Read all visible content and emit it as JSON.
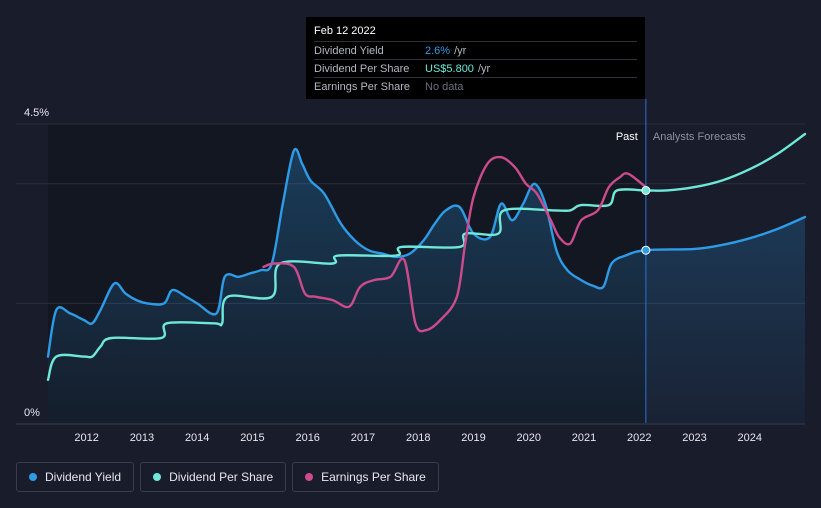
{
  "tooltip": {
    "date": "Feb 12 2022",
    "rows": [
      {
        "label": "Dividend Yield",
        "value": "2.6%",
        "unit": "/yr"
      },
      {
        "label": "Dividend Per Share",
        "value": "US$5.800",
        "unit": "/yr"
      },
      {
        "label": "Earnings Per Share",
        "value": "No data",
        "unit": ""
      }
    ]
  },
  "zones": {
    "past": "Past",
    "forecast": "Analysts Forecasts"
  },
  "legend": [
    {
      "label": "Dividend Yield",
      "color": "#2d9be6"
    },
    {
      "label": "Dividend Per Share",
      "color": "#6fe8d8"
    },
    {
      "label": "Earnings Per Share",
      "color": "#cc4b8c"
    }
  ],
  "chart_data": {
    "type": "line",
    "y_tick_labels": [
      "4.5%",
      "0%"
    ],
    "ylim": [
      0,
      4.5
    ],
    "xlim": [
      2011.3,
      2025.0
    ],
    "x_tick_labels": [
      "2012",
      "2013",
      "2014",
      "2015",
      "2016",
      "2017",
      "2018",
      "2019",
      "2020",
      "2021",
      "2022",
      "2023",
      "2024"
    ],
    "x_ticks": [
      2012,
      2013,
      2014,
      2015,
      2016,
      2017,
      2018,
      2019,
      2020,
      2021,
      2022,
      2023,
      2024
    ],
    "highlight_date": 2022.12,
    "past_zone_start": 2021.1,
    "grid": true,
    "series": [
      {
        "name": "Dividend Yield",
        "unit": "%",
        "color": "#2d9be6",
        "fill": true,
        "points": [
          [
            2011.3,
            1.0
          ],
          [
            2011.45,
            1.7
          ],
          [
            2011.7,
            1.65
          ],
          [
            2011.95,
            1.55
          ],
          [
            2012.1,
            1.5
          ],
          [
            2012.25,
            1.7
          ],
          [
            2012.5,
            2.1
          ],
          [
            2012.7,
            1.95
          ],
          [
            2012.9,
            1.85
          ],
          [
            2013.1,
            1.8
          ],
          [
            2013.4,
            1.8
          ],
          [
            2013.55,
            2.0
          ],
          [
            2013.8,
            1.9
          ],
          [
            2014.0,
            1.8
          ],
          [
            2014.35,
            1.65
          ],
          [
            2014.5,
            2.2
          ],
          [
            2014.75,
            2.2
          ],
          [
            2014.95,
            2.25
          ],
          [
            2015.15,
            2.3
          ],
          [
            2015.35,
            2.4
          ],
          [
            2015.55,
            3.3
          ],
          [
            2015.75,
            4.1
          ],
          [
            2015.9,
            3.9
          ],
          [
            2016.05,
            3.65
          ],
          [
            2016.3,
            3.45
          ],
          [
            2016.6,
            3.0
          ],
          [
            2016.85,
            2.75
          ],
          [
            2017.1,
            2.6
          ],
          [
            2017.35,
            2.55
          ],
          [
            2017.6,
            2.5
          ],
          [
            2017.85,
            2.55
          ],
          [
            2018.1,
            2.75
          ],
          [
            2018.3,
            3.0
          ],
          [
            2018.5,
            3.2
          ],
          [
            2018.75,
            3.25
          ],
          [
            2019.0,
            2.85
          ],
          [
            2019.3,
            2.8
          ],
          [
            2019.5,
            3.3
          ],
          [
            2019.7,
            3.05
          ],
          [
            2019.9,
            3.3
          ],
          [
            2020.1,
            3.6
          ],
          [
            2020.3,
            3.3
          ],
          [
            2020.5,
            2.6
          ],
          [
            2020.7,
            2.3
          ],
          [
            2020.95,
            2.15
          ],
          [
            2021.15,
            2.07
          ],
          [
            2021.35,
            2.05
          ],
          [
            2021.5,
            2.4
          ],
          [
            2021.75,
            2.52
          ],
          [
            2022.12,
            2.6
          ],
          [
            2023.0,
            2.62
          ],
          [
            2023.5,
            2.68
          ],
          [
            2024.0,
            2.78
          ],
          [
            2024.5,
            2.92
          ],
          [
            2025.0,
            3.1
          ]
        ]
      },
      {
        "name": "Dividend Per Share",
        "unit": "US$",
        "color": "#6fe8d8",
        "fill": false,
        "points": [
          [
            2011.3,
            0.65
          ],
          [
            2011.45,
            1.0
          ],
          [
            2011.95,
            1.0
          ],
          [
            2012.1,
            1.0
          ],
          [
            2012.25,
            1.15
          ],
          [
            2012.45,
            1.28
          ],
          [
            2013.35,
            1.28
          ],
          [
            2013.45,
            1.5
          ],
          [
            2014.3,
            1.5
          ],
          [
            2014.45,
            1.5
          ],
          [
            2014.55,
            1.9
          ],
          [
            2015.35,
            1.9
          ],
          [
            2015.5,
            2.4
          ],
          [
            2016.45,
            2.4
          ],
          [
            2016.55,
            2.52
          ],
          [
            2017.6,
            2.52
          ],
          [
            2017.7,
            2.65
          ],
          [
            2018.75,
            2.65
          ],
          [
            2018.85,
            2.85
          ],
          [
            2019.45,
            2.85
          ],
          [
            2019.55,
            3.2
          ],
          [
            2020.45,
            3.2
          ],
          [
            2020.75,
            3.2
          ],
          [
            2020.95,
            3.28
          ],
          [
            2021.45,
            3.28
          ],
          [
            2021.6,
            3.5
          ],
          [
            2022.12,
            3.5
          ],
          [
            2022.5,
            3.5
          ],
          [
            2023.0,
            3.55
          ],
          [
            2023.5,
            3.65
          ],
          [
            2024.0,
            3.82
          ],
          [
            2024.5,
            4.05
          ],
          [
            2025.0,
            4.35
          ]
        ]
      },
      {
        "name": "Earnings Per Share",
        "unit": "US$",
        "color": "#cc4b8c",
        "fill": false,
        "points": [
          [
            2015.2,
            2.35
          ],
          [
            2015.4,
            2.4
          ],
          [
            2015.75,
            2.35
          ],
          [
            2015.95,
            1.95
          ],
          [
            2016.15,
            1.9
          ],
          [
            2016.45,
            1.85
          ],
          [
            2016.75,
            1.75
          ],
          [
            2016.95,
            2.05
          ],
          [
            2017.2,
            2.15
          ],
          [
            2017.5,
            2.2
          ],
          [
            2017.75,
            2.45
          ],
          [
            2017.95,
            1.5
          ],
          [
            2018.15,
            1.4
          ],
          [
            2018.4,
            1.55
          ],
          [
            2018.7,
            1.9
          ],
          [
            2018.85,
            2.7
          ],
          [
            2019.0,
            3.4
          ],
          [
            2019.25,
            3.9
          ],
          [
            2019.5,
            4.0
          ],
          [
            2019.75,
            3.85
          ],
          [
            2019.95,
            3.6
          ],
          [
            2020.15,
            3.45
          ],
          [
            2020.4,
            3.05
          ],
          [
            2020.55,
            2.8
          ],
          [
            2020.75,
            2.7
          ],
          [
            2020.95,
            3.05
          ],
          [
            2021.25,
            3.2
          ],
          [
            2021.45,
            3.55
          ],
          [
            2021.65,
            3.7
          ],
          [
            2021.8,
            3.75
          ],
          [
            2022.12,
            3.55
          ]
        ]
      }
    ]
  }
}
